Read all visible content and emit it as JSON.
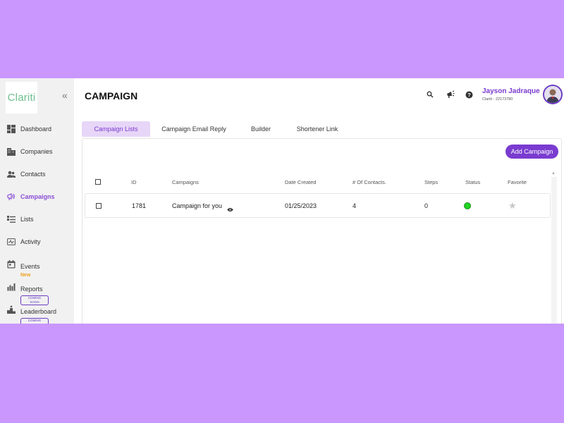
{
  "brand": {
    "logo_text": "Clariti"
  },
  "sidebar": {
    "collapse_icon": "«",
    "items": [
      {
        "label": "Dashboard",
        "icon": "dashboard-icon"
      },
      {
        "label": "Companies",
        "icon": "building-icon"
      },
      {
        "label": "Contacts",
        "icon": "contacts-icon"
      },
      {
        "label": "Campaigns",
        "icon": "campaign-icon",
        "active": true
      },
      {
        "label": "Lists",
        "icon": "list-icon"
      },
      {
        "label": "Activity",
        "icon": "activity-icon"
      },
      {
        "label": "Events",
        "icon": "calendar-icon",
        "sub": "New"
      },
      {
        "label": "Reports",
        "icon": "chart-icon",
        "badge": "COMING SOON"
      },
      {
        "label": "Leaderboard",
        "icon": "podium-icon",
        "badge": "COMING SOON"
      }
    ]
  },
  "header": {
    "title": "CAMPAIGN",
    "user_name": "Jayson Jadraque",
    "user_sub": "Clariti  -  22173780",
    "icons": [
      "search-icon",
      "megaphone-icon",
      "help-icon"
    ]
  },
  "tabs": [
    {
      "label": "Campaign Lists",
      "active": true
    },
    {
      "label": "Campaign Email Reply"
    },
    {
      "label": "Builder"
    },
    {
      "label": "Shortener Link"
    }
  ],
  "toolbar": {
    "add_label": "Add Campaign"
  },
  "table": {
    "columns": [
      "ID",
      "Campaigns",
      "Date Created",
      "# Of Contacts.",
      "Steps",
      "Status",
      "Favorite"
    ],
    "rows": [
      {
        "id": "1781",
        "campaign": "Campaign for you",
        "date": "01/25/2023",
        "contacts": "4",
        "steps": "0",
        "status": "active",
        "status_color": "#22d422",
        "favorite": false
      }
    ]
  },
  "colors": {
    "accent": "#7a3bd0",
    "background": "#c997fe",
    "tab_active_bg": "#e7d6f7"
  }
}
